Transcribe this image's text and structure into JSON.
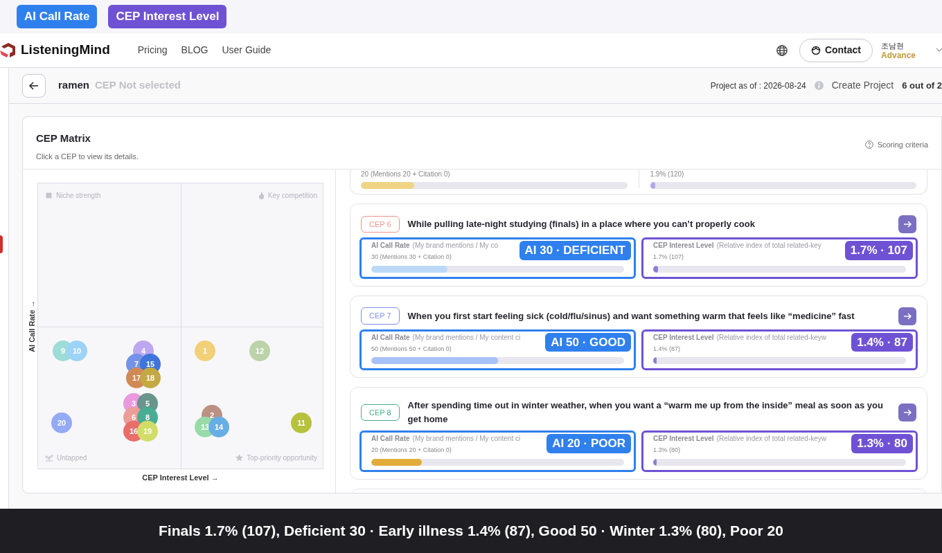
{
  "legend": [
    {
      "label": "AI Call Rate",
      "color": "#2f80ed"
    },
    {
      "label": "CEP Interest Level",
      "color": "#6f52d4"
    }
  ],
  "nav": {
    "brand": "ListeningMind",
    "links": [
      "Pricing",
      "BLOG",
      "User Guide"
    ],
    "contact": "Contact",
    "user": "조남현",
    "plan": "Advance"
  },
  "project": {
    "name": "ramen",
    "cep_status": "CEP Not selected",
    "as_of": "Project as of : 2026-08-24",
    "create": "Create Project",
    "count": "6 out of 2"
  },
  "matrix": {
    "title": "CEP Matrix",
    "subtitle": "Click a CEP to view its details.",
    "scoring": "Scoring criteria",
    "y_axis": "AI Call Rate →",
    "x_axis": "CEP Interest Level →",
    "quadrants": [
      "Niche strength",
      "Key competition",
      "Untapped",
      "Top-priority opportunity"
    ],
    "bubbles": [
      {
        "label": "9",
        "color": "#9edcd8"
      },
      {
        "label": "10",
        "color": "#9dd3f7"
      },
      {
        "label": "4",
        "color": "#bca8f0"
      },
      {
        "label": "1",
        "color": "#f2d078"
      },
      {
        "label": "12",
        "color": "#bcd2a9"
      },
      {
        "label": "7",
        "color": "#7593e6"
      },
      {
        "label": "15",
        "color": "#3e74dc"
      },
      {
        "label": "17",
        "color": "#d18a56"
      },
      {
        "label": "18",
        "color": "#c4a843"
      },
      {
        "label": "3",
        "color": "#e99ade"
      },
      {
        "label": "5",
        "color": "#69958c"
      },
      {
        "label": "6",
        "color": "#ec9d98"
      },
      {
        "label": "8",
        "color": "#49ad94"
      },
      {
        "label": "2",
        "color": "#ba9184"
      },
      {
        "label": "20",
        "color": "#94aaf6"
      },
      {
        "label": "11",
        "color": "#b6c23c"
      },
      {
        "label": "13",
        "color": "#98dba9"
      },
      {
        "label": "14",
        "color": "#67aee4"
      },
      {
        "label": "16",
        "color": "#e86e6c"
      },
      {
        "label": "19",
        "color": "#d2dd68"
      }
    ]
  },
  "partial_card": {
    "ai_value": "20 (Mentions 20 + Citation 0)",
    "ai_bar": {
      "level": 0.2,
      "color": "#f0d486"
    },
    "interest_value": "1.9% (120)",
    "interest_bar": {
      "level": 0.02
    }
  },
  "cards": [
    {
      "badge": "CEP 6",
      "color": "#f0928c",
      "title": "While pulling late-night studying (finals) in a place where you can’t properly cook",
      "ai_label": "AI Call Rate",
      "ai_note": "(My brand mentions / My co",
      "ai_value": "30 (Mentions 30 + Citation 0)",
      "ai_bar": {
        "level": 0.3,
        "color": "#bcdaf8"
      },
      "ai_tag": "AI 30 · DEFICIENT",
      "interest_label": "CEP Interest Level",
      "interest_note": "(Relative index of total related-key",
      "interest_value": "1.7% (107)",
      "interest_bar": {
        "level": 0.02
      },
      "interest_tag": "1.7% · 107"
    },
    {
      "badge": "CEP 7",
      "color": "#7c90e8",
      "title": "When you first start feeling sick (cold/flu/sinus) and want something warm that feels like “medicine” fast",
      "ai_label": "AI Call Rate",
      "ai_note": "(My brand mentions / My content ci",
      "ai_value": "50 (Mentions 50 + Citation 0)",
      "ai_bar": {
        "level": 0.5,
        "color": "#a8c1f7"
      },
      "ai_tag": "AI 50 · GOOD",
      "interest_label": "CEP Interest Level",
      "interest_note": "(Relative index of total related-keyw",
      "interest_value": "1.4% (87)",
      "interest_bar": {
        "level": 0.015
      },
      "interest_tag": "1.4% · 87"
    },
    {
      "badge": "CEP 8",
      "color": "#4daa8a",
      "title": "After spending time out in winter weather, when you want a “warm me up from the inside” meal as soon as you get home",
      "ai_label": "AI Call Rate",
      "ai_note": "(My brand mentions / My content ci",
      "ai_value": "20 (Mentions 20 + Citation 0)",
      "ai_bar": {
        "level": 0.2,
        "color": "#e2ac3a"
      },
      "ai_tag": "AI 20 · POOR",
      "interest_label": "CEP Interest Level",
      "interest_note": "(Relative index of total related-keyw",
      "interest_value": "1.3% (80)",
      "interest_bar": {
        "level": 0.013
      },
      "interest_tag": "1.3% · 80"
    }
  ],
  "caption": "Finals 1.7% (107), Deficient 30 · Early illness 1.4% (87), Good 50 · Winter 1.3% (80), Poor 20"
}
